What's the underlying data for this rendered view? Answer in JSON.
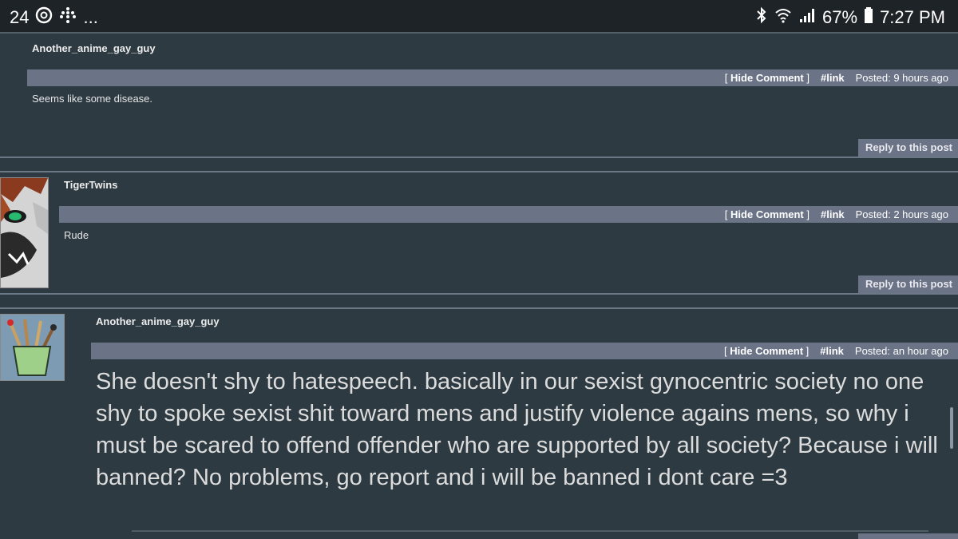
{
  "status": {
    "left_number": "24",
    "dots": "...",
    "battery": "67%",
    "time": "7:27 PM"
  },
  "labels": {
    "hide": "Hide Comment",
    "link": "#link",
    "reply": "Reply to this post",
    "bracket_open": "[",
    "bracket_close": "]"
  },
  "comments": [
    {
      "username": "Another_anime_gay_guy",
      "posted": "Posted: 9 hours ago",
      "text": "Seems like some disease."
    },
    {
      "username": "TigerTwins",
      "posted": "Posted: 2 hours ago",
      "text": "Rude"
    },
    {
      "username": "Another_anime_gay_guy",
      "posted": "Posted: an hour ago",
      "text": "She doesn't shy to hatespeech. basically in our sexist gynocentric society no one shy to spoke sexist shit toward mens and justify violence agains mens, so why i must be scared to offend offender who are supported by all society? Because i will banned? No problems, go report and i will be banned i dont care =3"
    }
  ],
  "colors": {
    "background": "#2d3a42",
    "bar": "#6b7387",
    "statusbar": "#1d2327"
  }
}
